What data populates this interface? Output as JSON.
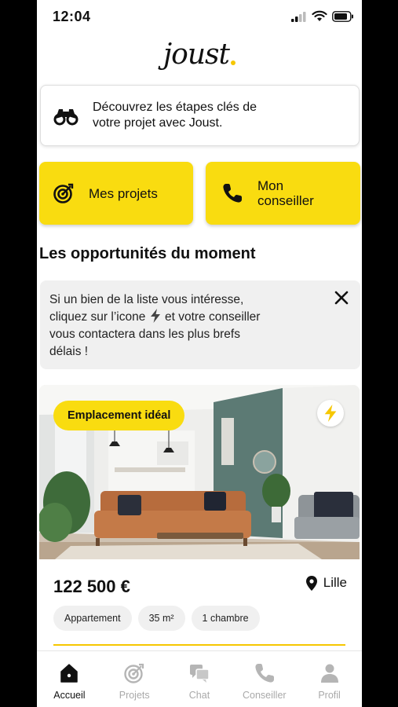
{
  "status": {
    "time": "12:04"
  },
  "logo": {
    "text": "joust"
  },
  "info_card": {
    "text_line1": "Découvrez les étapes clés de",
    "text_line2": "votre projet avec Joust."
  },
  "quick_actions": {
    "projects": "Mes projets",
    "advisor_line1": "Mon",
    "advisor_line2": "conseiller"
  },
  "section": {
    "title": "Les opportunités du moment"
  },
  "notice": {
    "line1": "Si un bien de la liste vous intéresse,",
    "line2_a": "cliquez sur l’icone",
    "line2_b": "et votre conseiller",
    "line3": "vous contactera dans les plus brefs",
    "line4": "délais !"
  },
  "property": {
    "badge": "Emplacement idéal",
    "price": "122 500 €",
    "city": "Lille",
    "tags": [
      "Appartement",
      "35 m²",
      "1 chambre"
    ]
  },
  "nav": {
    "items": [
      {
        "label": "Accueil",
        "icon": "home-icon",
        "active": true
      },
      {
        "label": "Projets",
        "icon": "target-icon",
        "active": false
      },
      {
        "label": "Chat",
        "icon": "chat-icon",
        "active": false
      },
      {
        "label": "Conseiller",
        "icon": "phone-icon",
        "active": false
      },
      {
        "label": "Profil",
        "icon": "profile-icon",
        "active": false
      }
    ]
  },
  "colors": {
    "accent": "#f9dc10",
    "text": "#111111",
    "inactive": "#a9a9a9",
    "notice_bg": "#f0f0f0"
  }
}
